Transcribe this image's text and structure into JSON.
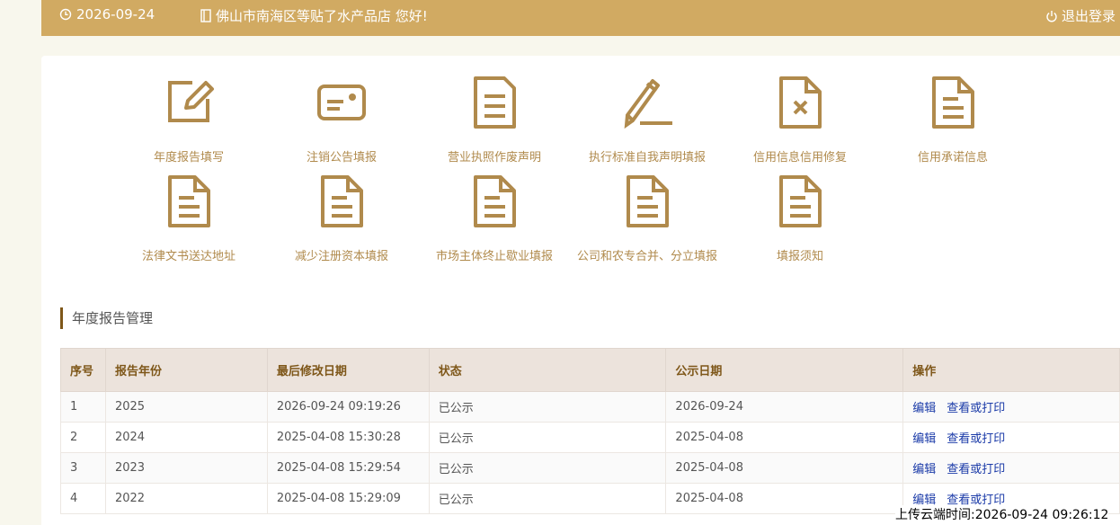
{
  "topbar": {
    "date": "2026-09-24",
    "greeting": "佛山市南海区等贴了水产品店 您好!",
    "logout": "退出登录"
  },
  "functions": [
    {
      "label": "年度报告填写",
      "icon": "edit-icon"
    },
    {
      "label": "注销公告填报",
      "icon": "id-card-icon"
    },
    {
      "label": "营业执照作废声明",
      "icon": "document-icon"
    },
    {
      "label": "执行标准自我声明填报",
      "icon": "pen-icon"
    },
    {
      "label": "信用信息信用修复",
      "icon": "document-x-icon"
    },
    {
      "label": "信用承诺信息",
      "icon": "document-icon"
    },
    {
      "label": "法律文书送达地址",
      "icon": "document-icon"
    },
    {
      "label": "减少注册资本填报",
      "icon": "document-icon"
    },
    {
      "label": "市场主体终止歇业填报",
      "icon": "document-icon"
    },
    {
      "label": "公司和农专合并、分立填报",
      "icon": "document-icon"
    },
    {
      "label": "填报须知",
      "icon": "document-icon"
    }
  ],
  "section": {
    "title": "年度报告管理"
  },
  "table": {
    "headers": [
      "序号",
      "报告年份",
      "最后修改日期",
      "状态",
      "公示日期",
      "操作"
    ],
    "rows": [
      [
        "1",
        "2025",
        "2026-09-24 09:19:26",
        "已公示",
        "2026-09-24"
      ],
      [
        "2",
        "2024",
        "2025-04-08 15:30:28",
        "已公示",
        "2025-04-08"
      ],
      [
        "3",
        "2023",
        "2025-04-08 15:29:54",
        "已公示",
        "2025-04-08"
      ],
      [
        "4",
        "2022",
        "2025-04-08 15:29:09",
        "已公示",
        "2025-04-08"
      ]
    ],
    "actions": {
      "edit": "编辑",
      "view": "查看或打印"
    }
  },
  "upload_time": "上传云端时间:2026-09-24 09:26:12",
  "colors": {
    "topbar": "#d1aa62",
    "icon": "#b08a4c",
    "link": "#1a3aa8",
    "header_bg": "#ece3dc"
  }
}
